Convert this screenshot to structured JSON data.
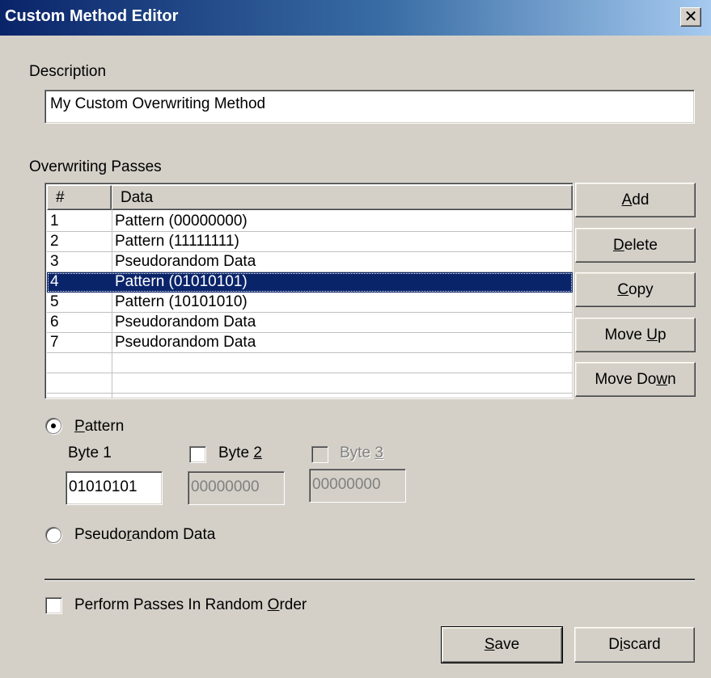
{
  "window": {
    "title": "Custom Method Editor",
    "close_glyph": "✕"
  },
  "description": {
    "label": "Description",
    "value": "My Custom Overwriting Method"
  },
  "passes": {
    "label": "Overwriting Passes",
    "columns": [
      "#",
      "Data"
    ],
    "rows": [
      {
        "num": "1",
        "data": "Pattern (00000000)"
      },
      {
        "num": "2",
        "data": "Pattern (11111111)"
      },
      {
        "num": "3",
        "data": "Pseudorandom Data"
      },
      {
        "num": "4",
        "data": "Pattern (01010101)"
      },
      {
        "num": "5",
        "data": "Pattern (10101010)"
      },
      {
        "num": "6",
        "data": "Pseudorandom Data"
      },
      {
        "num": "7",
        "data": "Pseudorandom Data"
      }
    ],
    "selected_row": "4"
  },
  "buttons": {
    "add": {
      "pre": "",
      "key": "A",
      "post": "dd"
    },
    "delete": {
      "pre": "",
      "key": "D",
      "post": "elete"
    },
    "copy": {
      "pre": "",
      "key": "C",
      "post": "opy"
    },
    "move_up": {
      "pre": "Move ",
      "key": "U",
      "post": "p"
    },
    "move_down": {
      "pre": "Move Do",
      "key": "w",
      "post": "n"
    },
    "save": {
      "pre": "",
      "key": "S",
      "post": "ave"
    },
    "discard": {
      "pre": "D",
      "key": "i",
      "post": "scard"
    }
  },
  "pattern": {
    "radio": {
      "pre": "",
      "key": "P",
      "post": "attern",
      "checked": true
    },
    "byte1": {
      "label": "Byte 1",
      "value": "01010101"
    },
    "byte2": {
      "label_pre": "Byte ",
      "label_key": "2",
      "value": "00000000",
      "checked": false,
      "enabled": false
    },
    "byte3": {
      "label_pre": "Byte ",
      "label_key": "3",
      "value": "00000000",
      "checked": false,
      "enabled": false
    }
  },
  "pseudorandom": {
    "pre": "Pseudo",
    "key": "r",
    "post": "andom Data",
    "checked": false
  },
  "random_order": {
    "pre": "Perform Passes In Random ",
    "key": "O",
    "post": "rder",
    "checked": false
  }
}
